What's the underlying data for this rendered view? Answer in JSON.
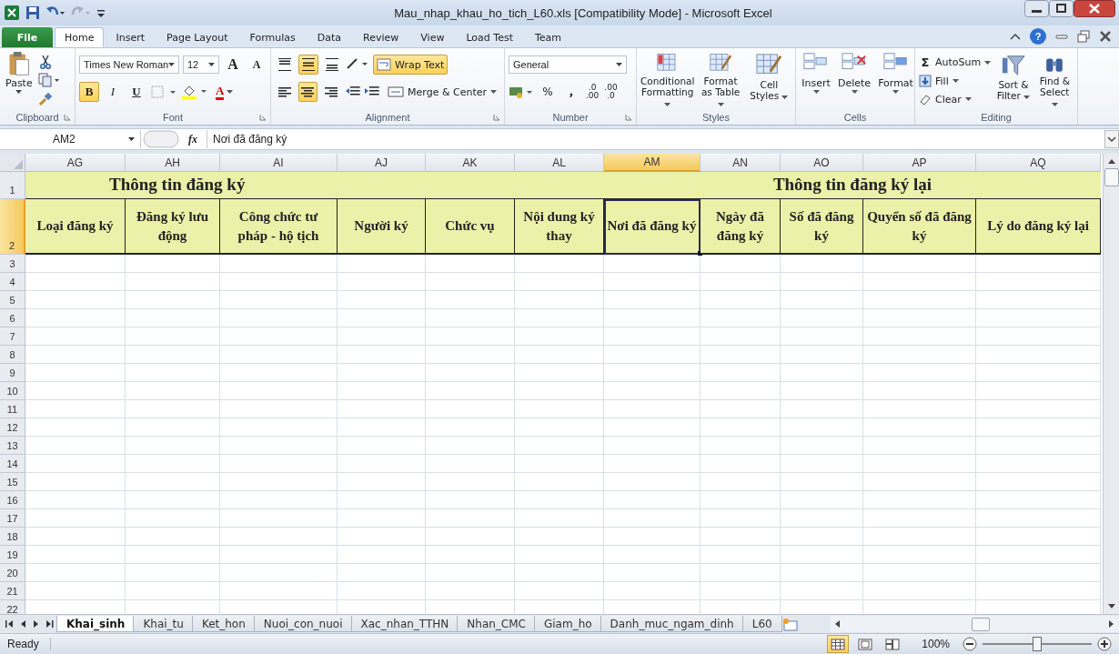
{
  "window": {
    "title": "Mau_nhap_khau_ho_tich_L60.xls  [Compatibility Mode]  -  Microsoft Excel"
  },
  "ribbon_tabs": [
    {
      "label": "File",
      "kind": "file",
      "selected": false
    },
    {
      "label": "Home",
      "kind": "tab",
      "selected": true
    },
    {
      "label": "Insert",
      "kind": "tab",
      "selected": false
    },
    {
      "label": "Page Layout",
      "kind": "tab",
      "selected": false
    },
    {
      "label": "Formulas",
      "kind": "tab",
      "selected": false
    },
    {
      "label": "Data",
      "kind": "tab",
      "selected": false
    },
    {
      "label": "Review",
      "kind": "tab",
      "selected": false
    },
    {
      "label": "View",
      "kind": "tab",
      "selected": false
    },
    {
      "label": "Load Test",
      "kind": "tab",
      "selected": false
    },
    {
      "label": "Team",
      "kind": "tab",
      "selected": false
    }
  ],
  "help": "?",
  "clipboard": {
    "label": "Clipboard",
    "paste": "Paste"
  },
  "font": {
    "label": "Font",
    "font_name": "Times New Roman",
    "font_size": "12",
    "grow": "A",
    "shrink": "A",
    "font_color": "A",
    "styles": [
      {
        "label": "B",
        "kind": "bold",
        "selected": true
      },
      {
        "label": "I",
        "kind": "italic",
        "selected": false
      },
      {
        "label": "U",
        "kind": "underline",
        "selected": false
      }
    ]
  },
  "alignment": {
    "label": "Alignment",
    "merge": "Merge & Center",
    "wrap_text": {
      "label": "Wrap Text",
      "selected": true
    },
    "vertical": [
      {
        "kind": "top",
        "selected": false
      },
      {
        "kind": "middle",
        "selected": true
      },
      {
        "kind": "bottom",
        "selected": false
      }
    ],
    "horizontal": [
      {
        "kind": "left",
        "selected": false
      },
      {
        "kind": "center",
        "selected": true
      },
      {
        "kind": "right",
        "selected": false
      }
    ]
  },
  "number": {
    "label": "Number",
    "format": "General",
    "percent": "%",
    "comma": ",",
    "decimals": [
      {
        "top": ".0",
        "bottom": ".00"
      },
      {
        "top": ".00",
        "bottom": ".0"
      }
    ]
  },
  "styles": {
    "label": "Styles",
    "buttons": [
      "Conditional Formatting",
      "Format as Table",
      "Cell Styles"
    ]
  },
  "cells": {
    "label": "Cells",
    "buttons": [
      "Insert",
      "Delete",
      "Format"
    ]
  },
  "editing": {
    "label": "Editing",
    "autosum_symbol": "Σ",
    "small": [
      "AutoSum",
      "Fill",
      "Clear"
    ],
    "large": [
      "Sort & Filter",
      "Find & Select"
    ]
  },
  "formula_bar": {
    "name_box": "AM2",
    "function_symbol": "fx",
    "formula": "Nơi đã đăng ký"
  },
  "sheet": {
    "columns": [
      {
        "label": "AG",
        "selected": false
      },
      {
        "label": "AH",
        "selected": false
      },
      {
        "label": "AI",
        "selected": false
      },
      {
        "label": "AJ",
        "selected": false
      },
      {
        "label": "AK",
        "selected": false
      },
      {
        "label": "AL",
        "selected": false
      },
      {
        "label": "AM",
        "selected": true
      },
      {
        "label": "AN",
        "selected": false
      },
      {
        "label": "AO",
        "selected": false
      },
      {
        "label": "AP",
        "selected": false
      },
      {
        "label": "AQ",
        "selected": false
      }
    ],
    "groups": [
      {
        "title": "Thông tin đăng ký",
        "headers": [
          {
            "text": "Loại đăng ký",
            "selected": false
          },
          {
            "text": "Đăng ký lưu động",
            "selected": false
          },
          {
            "text": "Công chức tư pháp - hộ tịch",
            "selected": false
          },
          {
            "text": "Người ký",
            "selected": false
          },
          {
            "text": "Chức vụ",
            "selected": false
          },
          {
            "text": "Nội dung ký thay",
            "selected": false
          }
        ]
      },
      {
        "title": "Thông tin đăng ký lại",
        "headers": [
          {
            "text": "Nơi đã đăng ký",
            "selected": true
          },
          {
            "text": "Ngày đã đăng ký",
            "selected": false
          },
          {
            "text": "Số đã đăng ký",
            "selected": false
          },
          {
            "text": "Quyển số đã đăng ký",
            "selected": false
          },
          {
            "text": "Lý do đăng ký lại",
            "selected": false
          }
        ]
      }
    ],
    "row_numbers": [
      {
        "label": "1",
        "selected": false
      },
      {
        "label": "2",
        "selected": true
      },
      {
        "label": "3",
        "selected": false
      },
      {
        "label": "4",
        "selected": false
      },
      {
        "label": "5",
        "selected": false
      },
      {
        "label": "6",
        "selected": false
      },
      {
        "label": "7",
        "selected": false
      },
      {
        "label": "8",
        "selected": false
      },
      {
        "label": "9",
        "selected": false
      },
      {
        "label": "10",
        "selected": false
      },
      {
        "label": "11",
        "selected": false
      },
      {
        "label": "12",
        "selected": false
      },
      {
        "label": "13",
        "selected": false
      },
      {
        "label": "14",
        "selected": false
      },
      {
        "label": "15",
        "selected": false
      },
      {
        "label": "16",
        "selected": false
      },
      {
        "label": "17",
        "selected": false
      },
      {
        "label": "18",
        "selected": false
      },
      {
        "label": "19",
        "selected": false
      },
      {
        "label": "20",
        "selected": false
      },
      {
        "label": "21",
        "selected": false
      },
      {
        "label": "22",
        "selected": false
      }
    ]
  },
  "sheet_tabs": [
    {
      "label": "Khai_sinh",
      "selected": true
    },
    {
      "label": "Khai_tu",
      "selected": false
    },
    {
      "label": "Ket_hon",
      "selected": false
    },
    {
      "label": "Nuoi_con_nuoi",
      "selected": false
    },
    {
      "label": "Xac_nhan_TTHN",
      "selected": false
    },
    {
      "label": "Nhan_CMC",
      "selected": false
    },
    {
      "label": "Giam_ho",
      "selected": false
    },
    {
      "label": "Danh_muc_ngam_dinh",
      "selected": false
    },
    {
      "label": "L60",
      "selected": false
    }
  ],
  "status_bar": {
    "status": "Ready",
    "zoom": "100%",
    "zoom_slider": {
      "level": 0.5
    },
    "views": [
      {
        "kind": "normal",
        "selected": true
      },
      {
        "kind": "page_layout",
        "selected": false
      },
      {
        "kind": "page_break",
        "selected": false
      }
    ]
  }
}
